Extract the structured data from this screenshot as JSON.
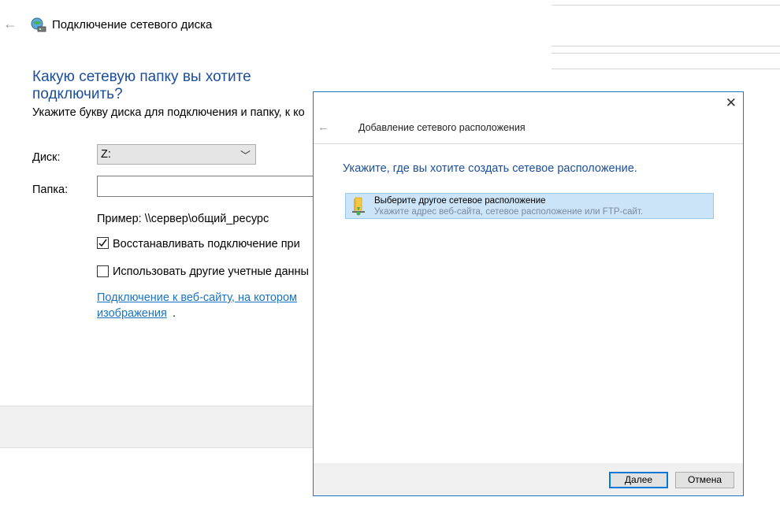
{
  "background_wizard": {
    "title": "Подключение сетевого диска",
    "heading": "Какую сетевую папку вы хотите подключить?",
    "instruction": "Укажите букву диска для подключения и папку, к ко",
    "drive_label": "Диск:",
    "drive_value": "Z:",
    "folder_label": "Папка:",
    "folder_value": "",
    "example": "Пример: \\\\сервер\\общий_ресурс",
    "reconnect_label": "Восстанавливать подключение при",
    "reconnect_checked": true,
    "other_creds_label": "Использовать другие учетные данны",
    "other_creds_checked": false,
    "link_line1": "Подключение к веб-сайту, на котором",
    "link_line2": "изображения",
    "link_trailing": "."
  },
  "dialog": {
    "title": "Добавление сетевого расположения",
    "heading": "Укажите, где вы хотите создать сетевое расположение.",
    "option": {
      "title": "Выберите другое сетевое расположение",
      "subtitle": "Укажите адрес веб-сайта, сетевое расположение или FTP-сайт.",
      "icon": "network-folder-icon"
    },
    "next_button": "Далее",
    "cancel_button": "Отмена",
    "close_glyph": "✕",
    "back_glyph": "←"
  },
  "colors": {
    "heading_blue": "#1c4e9c",
    "link_blue": "#1a73c4",
    "selection_bg": "#cce4f7",
    "dialog_border": "#1f78c6"
  }
}
